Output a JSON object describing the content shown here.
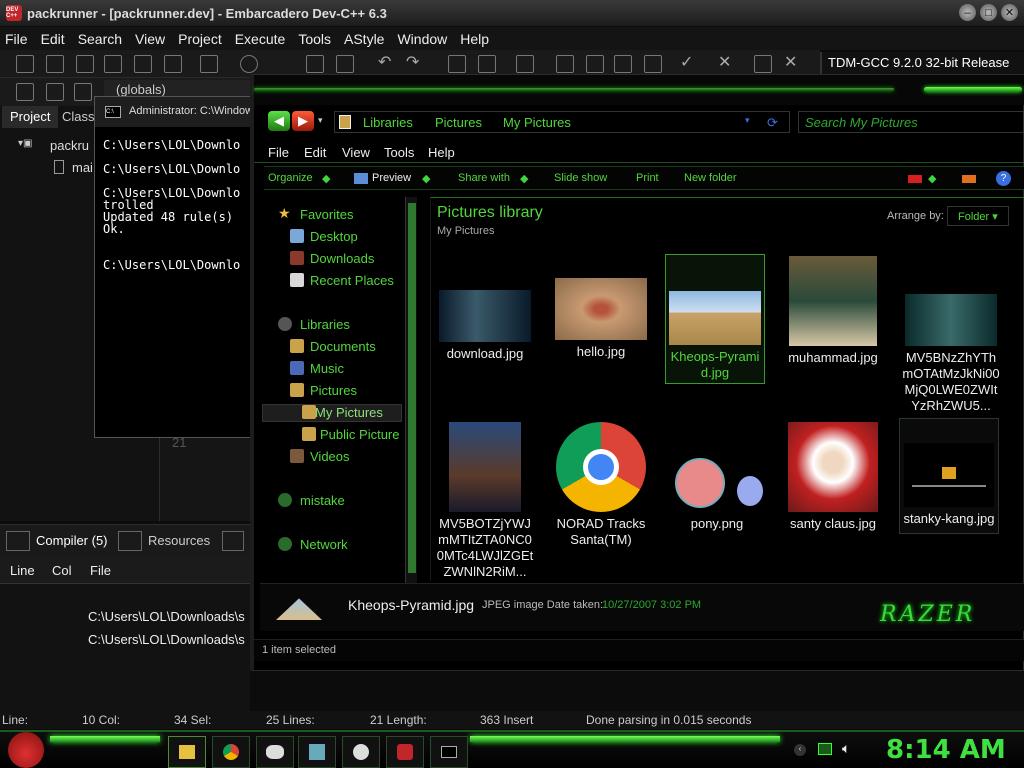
{
  "devcpp": {
    "app_icon_label": "DEV C++",
    "title": "packrunner - [packrunner.dev] - Embarcadero Dev-C++ 6.3",
    "menu": [
      "File",
      "Edit",
      "Search",
      "View",
      "Project",
      "Execute",
      "Tools",
      "AStyle",
      "Window",
      "Help"
    ],
    "compiler": "TDM-GCC 9.2.0 32-bit Release",
    "globals": "(globals)",
    "panel_tabs": {
      "project": "Project",
      "classes": "Class"
    },
    "tree": {
      "root": "packru",
      "child": "mai"
    },
    "line_number": "21",
    "bottom_tabs": {
      "compiler": "Compiler (5)",
      "resources": "Resources"
    },
    "table_headers": {
      "line": "Line",
      "col": "Col",
      "file": "File"
    },
    "rows": [
      "C:\\Users\\LOL\\Downloads\\s",
      "C:\\Users\\LOL\\Downloads\\s"
    ],
    "status": {
      "line": "Line:",
      "col": "10 Col:",
      "sel": "34 Sel:",
      "lines": "25 Lines:",
      "length": "21 Length:",
      "insert": "363 Insert",
      "parse": "Done parsing in 0.015 seconds"
    }
  },
  "console": {
    "title": "Administrator: C:\\Window",
    "icon_label": "C:\\",
    "lines": "C:\\Users\\LOL\\Downlo\n\nC:\\Users\\LOL\\Downlo\n\nC:\\Users\\LOL\\Downlo\ntrolled\nUpdated 48 rule(s)\nOk.\n\n\nC:\\Users\\LOL\\Downlo"
  },
  "explorer": {
    "breadcrumb": [
      "Libraries",
      "Pictures",
      "My Pictures"
    ],
    "search_placeholder": "Search My Pictures",
    "menu": [
      "File",
      "Edit",
      "View",
      "Tools",
      "Help"
    ],
    "commands": [
      "Organize",
      "Preview",
      "Share with",
      "Slide show",
      "Print",
      "New folder"
    ],
    "nav": {
      "favorites": "Favorites",
      "desktop": "Desktop",
      "downloads": "Downloads",
      "recent": "Recent Places",
      "libraries": "Libraries",
      "documents": "Documents",
      "music": "Music",
      "pictures": "Pictures",
      "my_pictures": "My Pictures",
      "public_pictures": "Public Picture",
      "videos": "Videos",
      "mistake": "mistake",
      "network": "Network"
    },
    "library_title": "Pictures library",
    "library_sub": "My Pictures",
    "arrange_label": "Arrange by:",
    "arrange_value": "Folder",
    "files": [
      {
        "name": "download.jpg"
      },
      {
        "name": "hello.jpg"
      },
      {
        "name": "Kheops-Pyramid.jpg"
      },
      {
        "name": "muhammad.jpg"
      },
      {
        "name": "MV5BNzZhYThmOTAtMzJkNi00MjQ0LWE0ZWItYzRhZWU5..."
      },
      {
        "name": "MV5BOTZjYWJmMTItZTA0NC00MTc4LWJlZGEtZWNlN2RiM..."
      },
      {
        "name": "NORAD Tracks Santa(TM)"
      },
      {
        "name": "pony.png"
      },
      {
        "name": "santy claus.jpg"
      },
      {
        "name": "stanky-kang.jpg"
      }
    ],
    "details": {
      "name": "Kheops-Pyramid.jpg",
      "type": "JPEG image Date taken:",
      "date": "10/27/2007 3:02 PM",
      "brand": "RAZER"
    },
    "status": "1 item selected"
  },
  "taskbar": {
    "clock": "8:14 AM"
  }
}
